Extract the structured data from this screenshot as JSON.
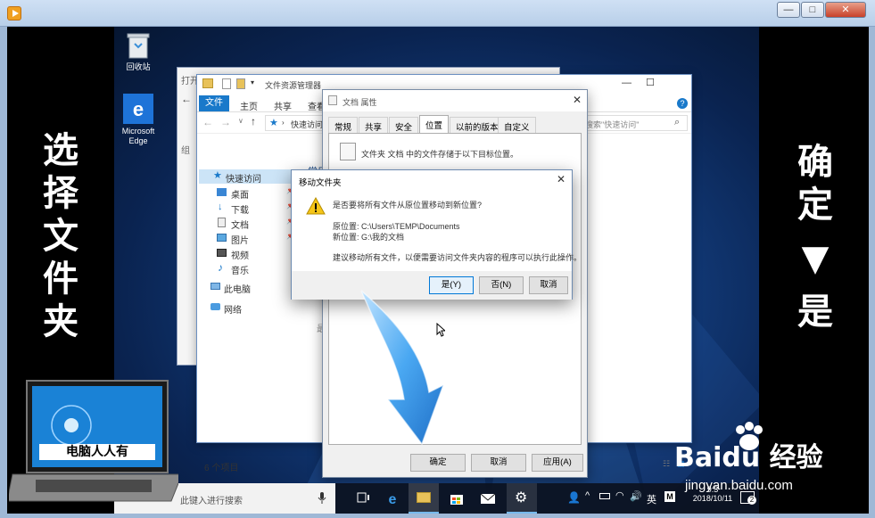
{
  "outer": {
    "title": "",
    "btn_min": "—",
    "btn_max": "□",
    "btn_close": "✕"
  },
  "left_caption": [
    "选",
    "择",
    "文",
    "件",
    "夹"
  ],
  "right_caption": [
    "确",
    "定",
    "▼",
    "是"
  ],
  "desktop": {
    "recycle_label": "回收站",
    "edge_label_1": "Microsoft",
    "edge_label_2": "Edge"
  },
  "back_window": {
    "title": "打开"
  },
  "explorer": {
    "title": "文件资源管理器",
    "ribbon_tabs": [
      "文件",
      "主页",
      "共享",
      "查看"
    ],
    "address": "快速访问",
    "search_placeholder": "搜索\"快速访问\"",
    "section_header": "常用",
    "nav_quick": "快速访问",
    "nav_items": [
      "桌面",
      "下载",
      "文档",
      "图片",
      "视频",
      "音乐"
    ],
    "nav_pc": "此电脑",
    "nav_network": "网络",
    "status": "6 个项目",
    "ghost_text": "组",
    "ghost_text2": "最"
  },
  "props": {
    "title": "文档 属性",
    "tabs": [
      "常规",
      "共享",
      "安全",
      "位置",
      "以前的版本",
      "自定义"
    ],
    "desc": "文件夹 文档 中的文件存储于以下目标位置。",
    "btn_ok": "确定",
    "btn_cancel": "取消",
    "btn_apply": "应用(A)"
  },
  "move_dialog": {
    "title": "移动文件夹",
    "question": "是否要将所有文件从原位置移动到新位置?",
    "old_loc": "原位置: C:\\Users\\TEMP\\Documents",
    "new_loc": "新位置: G:\\我的文档",
    "hint": "建议移动所有文件，以便需要访问文件夹内容的程序可以执行此操作。",
    "btn_yes": "是(Y)",
    "btn_no": "否(N)",
    "btn_cancel": "取消"
  },
  "taskbar": {
    "search_placeholder": "此键入进行搜索",
    "ime": "英",
    "time": "9:3",
    "date": "2018/10/11",
    "notif_count": "2"
  },
  "logo_text": "电脑人人有",
  "watermark": {
    "brand": "Baidu 经验",
    "url": "jingyan.baidu.com"
  },
  "colors": {
    "accent": "#0078d7",
    "desktop_dark": "#0a2350",
    "arrow": "#3d9ff0"
  }
}
